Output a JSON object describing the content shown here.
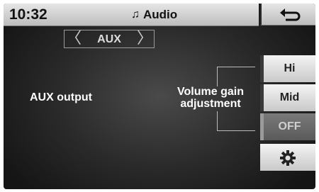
{
  "status_bar": {
    "time": "10:32",
    "title": "Audio",
    "title_icon": "music-note-icon"
  },
  "back_button": {
    "icon": "back-arrow-icon"
  },
  "source_selector": {
    "value": "AUX",
    "prev_glyph": "〈",
    "next_glyph": "〉"
  },
  "main": {
    "aux_output_label": "AUX output",
    "volume_gain_line1": "Volume gain",
    "volume_gain_line2": "adjustment"
  },
  "gain_options": [
    {
      "label": "Hi",
      "active": false
    },
    {
      "label": "Mid",
      "active": false
    },
    {
      "label": "OFF",
      "active": true
    }
  ],
  "settings_button": {
    "icon": "gear-icon"
  }
}
